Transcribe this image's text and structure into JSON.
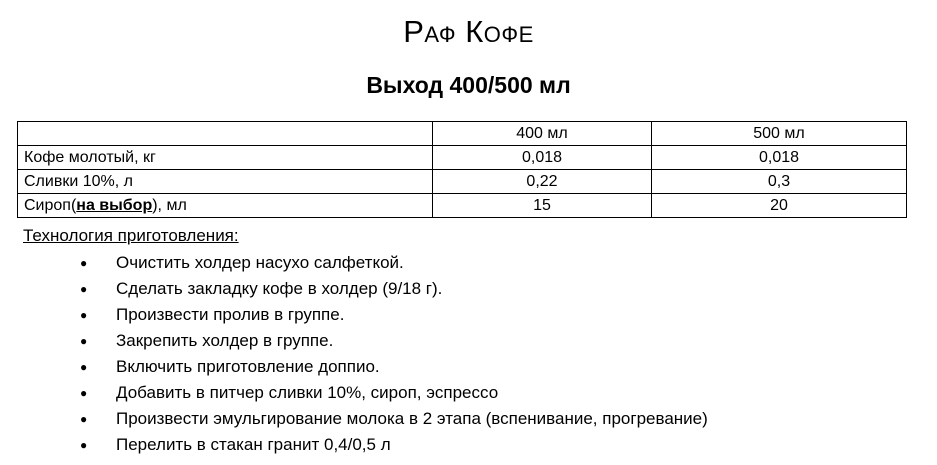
{
  "title": "Раф Кофе",
  "subtitle": "Выход 400/500 мл",
  "table": {
    "header": [
      "",
      "400 мл",
      "500 мл"
    ],
    "rows": [
      {
        "name": "Кофе молотый, кг",
        "v400": "0,018",
        "v500": "0,018"
      },
      {
        "name": "Сливки 10%, л",
        "v400": "0,22",
        "v500": "0,3"
      },
      {
        "name_prefix": "Сироп(",
        "name_bold": "на выбор",
        "name_suffix": "), мл",
        "v400": "15",
        "v500": "20"
      }
    ]
  },
  "tech_heading": "Технология приготовления:",
  "bullet_glyph": "●",
  "steps": [
    "Очистить холдер насухо салфеткой.",
    "Сделать закладку кофе в холдер (9/18 г).",
    "Произвести пролив в группе.",
    "Закрепить холдер в группе.",
    "Включить приготовление доппио.",
    "Добавить в питчер сливки 10%, сироп, эспрессо",
    "Произвести эмульгирование молока в 2 этапа (вспенивание, прогревание)",
    "Перелить в стакан гранит 0,4/0,5 л"
  ]
}
